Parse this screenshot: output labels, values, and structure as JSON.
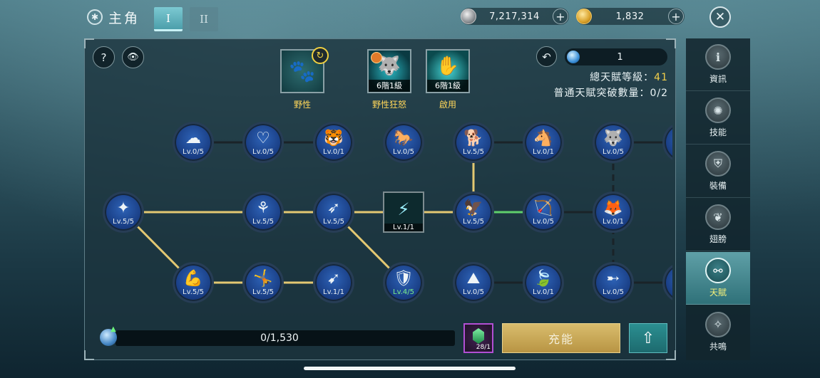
{
  "header": {
    "title": "主角",
    "tabs": [
      {
        "label": "I",
        "active": true
      },
      {
        "label": "II",
        "active": false
      }
    ],
    "silver": "7,217,314",
    "gold": "1,832",
    "plus_label": "+",
    "close_label": "✕"
  },
  "panel": {
    "help_label": "?",
    "view_label": "👁",
    "skills": [
      {
        "name": "野性",
        "tier": "",
        "glyph": "🐾"
      },
      {
        "name": "野性狂怒",
        "tier": "6階1級",
        "glyph": "🐺"
      },
      {
        "name": "啟用",
        "tier": "6階1級",
        "glyph": "✋"
      }
    ],
    "refresh_label": "↻",
    "reset_label": "↶",
    "gem_count": "1",
    "total_level_label": "總天賦等級：",
    "total_level_value": "41",
    "breakthrough_label": "普通天賦突破數量：",
    "breakthrough_value": "0/2"
  },
  "tree": {
    "nodes": [
      {
        "id": "n1",
        "lv": "Lv.0/5",
        "glyph": "☁",
        "state": "on"
      },
      {
        "id": "n2",
        "lv": "Lv.0/5",
        "glyph": "♡",
        "state": "on"
      },
      {
        "id": "n3",
        "lv": "Lv.0/1",
        "glyph": "🐯",
        "state": "on"
      },
      {
        "id": "n4",
        "lv": "Lv.0/5",
        "glyph": "🐎",
        "state": "on"
      },
      {
        "id": "n5",
        "lv": "Lv.5/5",
        "glyph": "🐕",
        "state": "on"
      },
      {
        "id": "n6",
        "lv": "Lv.0/1",
        "glyph": "🐴",
        "state": "on"
      },
      {
        "id": "n7",
        "lv": "Lv.0/5",
        "glyph": "🐺",
        "state": "on"
      },
      {
        "id": "n8",
        "lv": "Lv.5/5",
        "glyph": "✦",
        "state": "on"
      },
      {
        "id": "n9",
        "lv": "Lv.5/5",
        "glyph": "⚘",
        "state": "on"
      },
      {
        "id": "n10",
        "lv": "Lv.5/5",
        "glyph": "➶",
        "state": "on"
      },
      {
        "id": "n11",
        "lv": "Lv.1/1",
        "glyph": "⚡",
        "state": "square"
      },
      {
        "id": "n12",
        "lv": "Lv.5/5",
        "glyph": "🦅",
        "state": "on"
      },
      {
        "id": "n13",
        "lv": "Lv.0/5",
        "glyph": "🏹",
        "state": "on"
      },
      {
        "id": "n14",
        "lv": "Lv.0/1",
        "glyph": "🦊",
        "state": "on"
      },
      {
        "id": "n15",
        "lv": "Lv.5/5",
        "glyph": "💪",
        "state": "on"
      },
      {
        "id": "n16",
        "lv": "Lv.5/5",
        "glyph": "🤸",
        "state": "on"
      },
      {
        "id": "n17",
        "lv": "Lv.1/1",
        "glyph": "➹",
        "state": "on"
      },
      {
        "id": "n18",
        "lv": "Lv.4/5",
        "glyph": "🛡",
        "state": "on"
      },
      {
        "id": "n19",
        "lv": "Lv.0/5",
        "glyph": "⛰",
        "state": "on"
      },
      {
        "id": "n20",
        "lv": "Lv.0/1",
        "glyph": "🍃",
        "state": "on"
      },
      {
        "id": "n21",
        "lv": "Lv.0/5",
        "glyph": "➸",
        "state": "on"
      }
    ]
  },
  "footer": {
    "xp_text": "0/1,530",
    "xp_fraction": 0,
    "item_count": "28/1",
    "charge_label": "充能",
    "upgrade_label": "⇧"
  },
  "sidebar": {
    "items": [
      {
        "label": "資訊",
        "glyph": "ℹ",
        "active": false
      },
      {
        "label": "技能",
        "glyph": "✺",
        "active": false
      },
      {
        "label": "裝備",
        "glyph": "⛨",
        "active": false
      },
      {
        "label": "翅膀",
        "glyph": "❦",
        "active": false
      },
      {
        "label": "天賦",
        "glyph": "⚯",
        "active": true
      },
      {
        "label": "共鳴",
        "glyph": "✧",
        "active": false
      }
    ]
  },
  "colors": {
    "accent_gold": "#f3d04a",
    "link_active": "#e3c872",
    "link_green": "#5fcf6c",
    "sidebar_active": "#4f9199"
  }
}
